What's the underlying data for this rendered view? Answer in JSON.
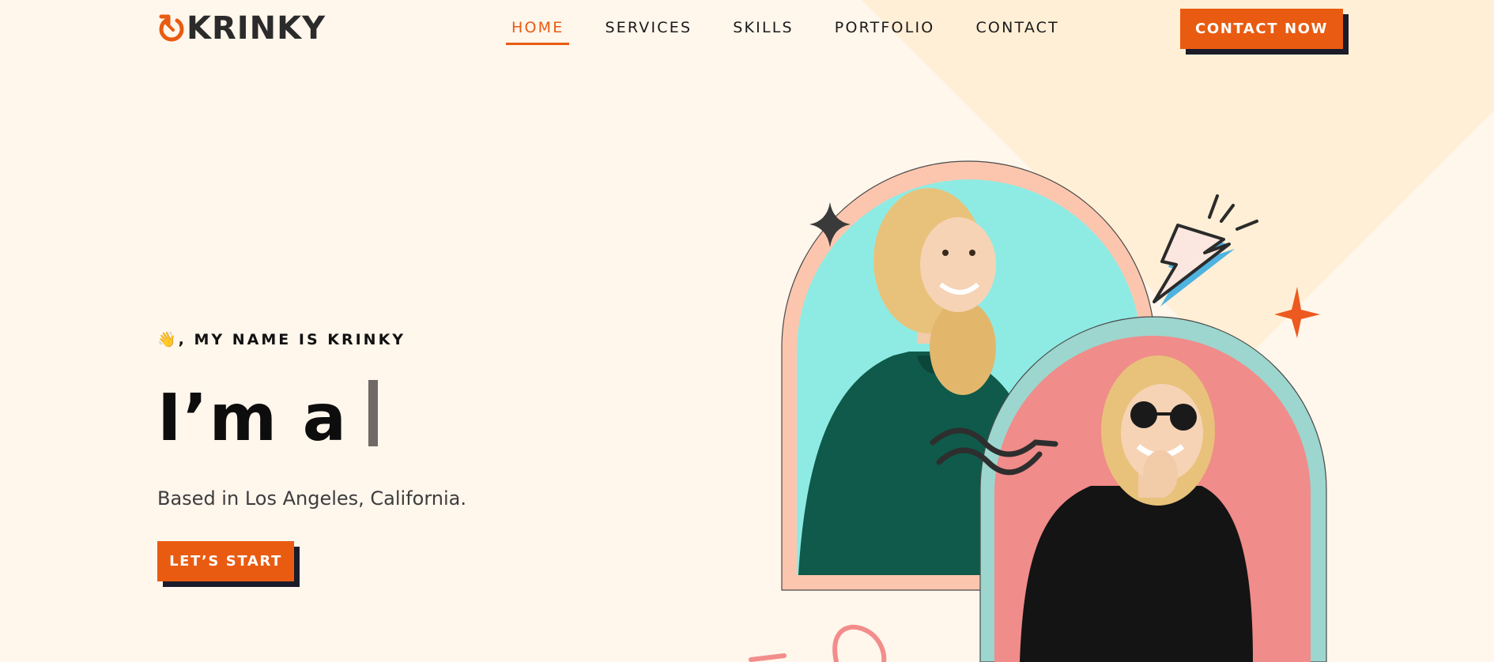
{
  "brand": {
    "name": "KRINKY",
    "accent": "#e95b11",
    "dark": "#1b1b2a"
  },
  "nav": {
    "items": [
      {
        "label": "HOME",
        "active": true
      },
      {
        "label": "SERVICES",
        "active": false
      },
      {
        "label": "SKILLS",
        "active": false
      },
      {
        "label": "PORTFOLIO",
        "active": false
      },
      {
        "label": "CONTACT",
        "active": false
      }
    ],
    "cta_label": "CONTACT NOW"
  },
  "hero": {
    "intro": "👋, MY NAME IS KRINKY",
    "headline": "I’m a",
    "location": "Based in Los Angeles, California.",
    "cta_label": "LET’S START"
  },
  "images": [
    {
      "name": "woman-green-hoodie-photo",
      "bg": "#8eebe4",
      "frame": "#fcc6ae"
    },
    {
      "name": "woman-sunglasses-photo",
      "bg": "#f08c8a",
      "frame": "#9cd6ce"
    }
  ]
}
